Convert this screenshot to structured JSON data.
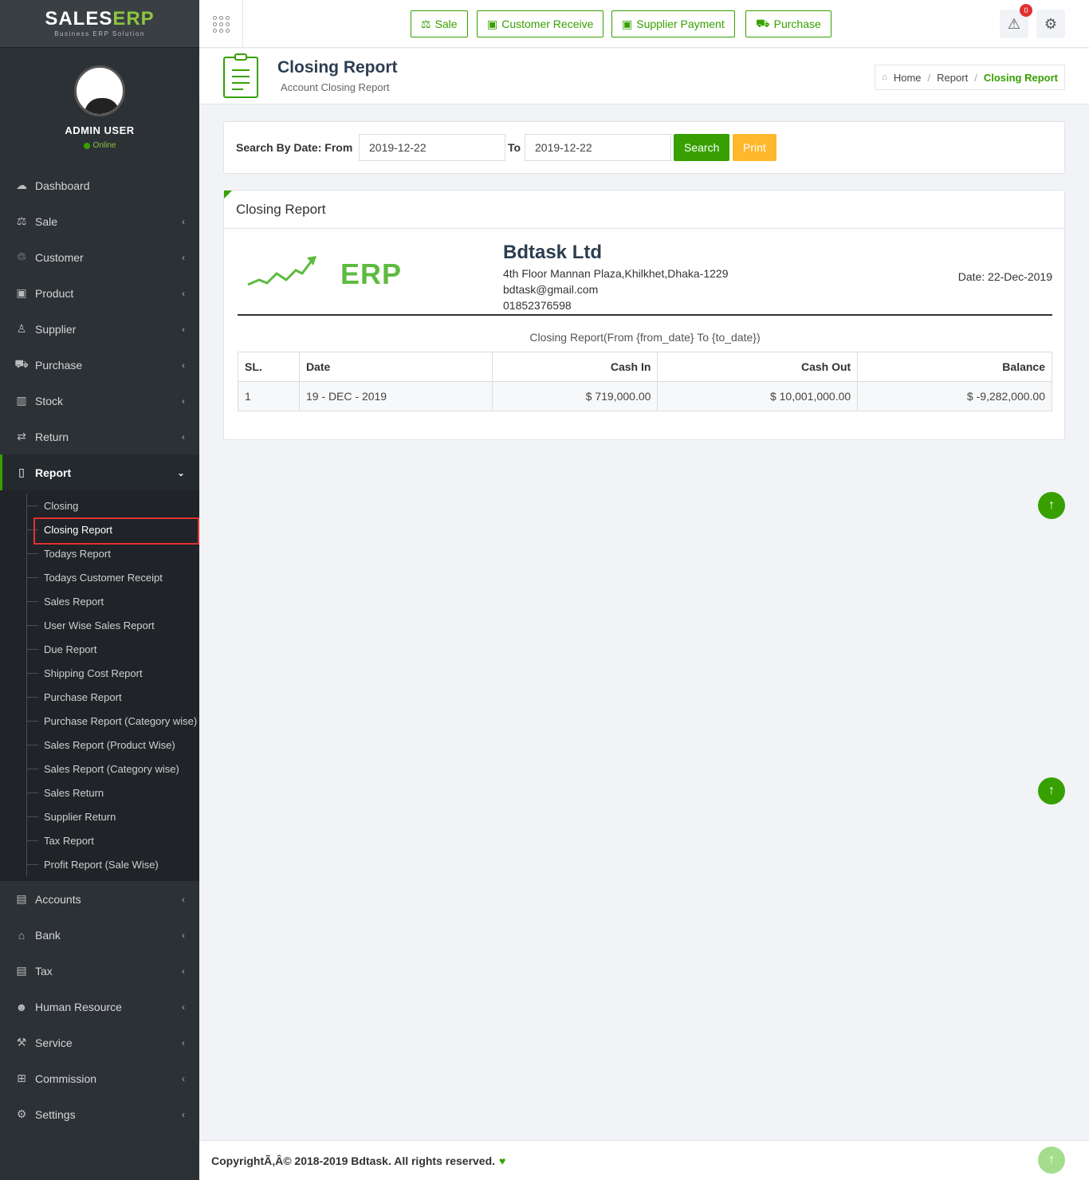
{
  "brand": {
    "name_main": "SALES",
    "name_accent": "ERP",
    "tagline": "Business ERP Solution"
  },
  "user": {
    "name": "ADMIN USER",
    "status": "Online"
  },
  "sidebar": {
    "items": [
      {
        "label": "Dashboard",
        "icon": "dashboard-icon"
      },
      {
        "label": "Sale",
        "icon": "balance-scale-icon"
      },
      {
        "label": "Customer",
        "icon": "handshake-icon"
      },
      {
        "label": "Product",
        "icon": "bag-icon"
      },
      {
        "label": "Supplier",
        "icon": "user-icon"
      },
      {
        "label": "Purchase",
        "icon": "cart-icon"
      },
      {
        "label": "Stock",
        "icon": "bar-chart-icon"
      },
      {
        "label": "Return",
        "icon": "retweet-icon"
      },
      {
        "label": "Report",
        "icon": "book-icon"
      },
      {
        "label": "Accounts",
        "icon": "money-icon"
      },
      {
        "label": "Bank",
        "icon": "bank-icon"
      },
      {
        "label": "Tax",
        "icon": "money-icon"
      },
      {
        "label": "Human Resource",
        "icon": "users-icon"
      },
      {
        "label": "Service",
        "icon": "wrench-icon"
      },
      {
        "label": "Commission",
        "icon": "grid-icon"
      },
      {
        "label": "Settings",
        "icon": "gear-icon"
      }
    ],
    "report_submenu": [
      "Closing",
      "Closing Report",
      "Todays Report",
      "Todays Customer Receipt",
      "Sales Report",
      "User Wise Sales Report",
      "Due Report",
      "Shipping Cost Report",
      "Purchase Report",
      "Purchase Report (Category wise)",
      "Sales Report (Product Wise)",
      "Sales Report (Category wise)",
      "Sales Return",
      "Supplier Return",
      "Tax Report",
      "Profit Report (Sale Wise)"
    ]
  },
  "topbar": {
    "quick_buttons": [
      "Sale",
      "Customer Receive",
      "Supplier Payment",
      "Purchase"
    ],
    "notification_count": "0"
  },
  "header": {
    "title": "Closing Report",
    "subtitle": "Account Closing Report",
    "breadcrumb": [
      "Home",
      "Report",
      "Closing Report"
    ]
  },
  "search": {
    "label_from": "Search By Date: From",
    "label_to": "To",
    "from_value": "2019-12-22",
    "to_value": "2019-12-22",
    "search_label": "Search",
    "print_label": "Print"
  },
  "report": {
    "panel_title": "Closing Report",
    "logo_text": "ERP",
    "company_name": "Bdtask Ltd",
    "address": "4th Floor Mannan Plaza,Khilkhet,Dhaka-1229",
    "email": "bdtask@gmail.com",
    "phone": "01852376598",
    "date": "Date: 22-Dec-2019",
    "caption": "Closing Report(From {from_date} To {to_date})",
    "columns": [
      "SL.",
      "Date",
      "Cash In",
      "Cash Out",
      "Balance"
    ],
    "rows": [
      {
        "sl": "1",
        "date": "19 - DEC - 2019",
        "cash_in": "$ 719,000.00",
        "cash_out": "$ 10,001,000.00",
        "balance": "$ -9,282,000.00"
      }
    ]
  },
  "footer": {
    "text": "CopyrightÃ‚Â© 2018-2019 Bdtask. All rights reserved."
  },
  "colors": {
    "accent": "#37a000",
    "warning": "#ffb72b",
    "sidebar": "#2c3136",
    "highlight": "#e03131"
  }
}
